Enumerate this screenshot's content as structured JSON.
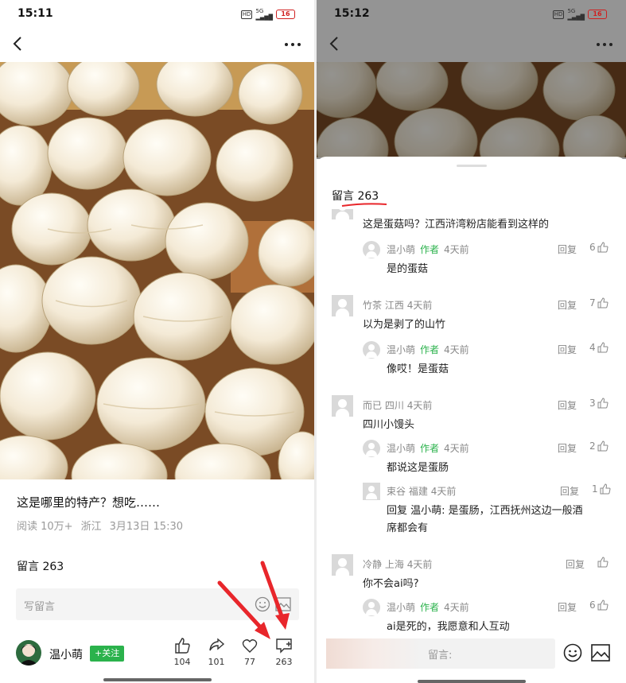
{
  "left": {
    "status": {
      "time": "15:11",
      "battery": "16"
    },
    "post": {
      "title": "这是哪里的特产？想吃……",
      "reads": "阅读 10万+",
      "location": "浙江",
      "datetime": "3月13日 15:30"
    },
    "comments_label": "留言 263",
    "input_placeholder": "写留言",
    "author": {
      "name": "温小萌",
      "follow": "+关注"
    },
    "actions": {
      "like": "104",
      "share": "101",
      "heart": "77",
      "comment": "263"
    }
  },
  "right": {
    "status": {
      "time": "15:12",
      "battery": "16"
    },
    "sheet_title": "留言 263",
    "reply_label": "回复",
    "author_tag": "作者",
    "comments": [
      {
        "text": "这是蛋菇吗？江西浒湾粉店能看到这样的"
      },
      {
        "name": "温小萌",
        "author": true,
        "time": "4天前",
        "likes": "6",
        "text": "是的蛋菇"
      },
      {
        "name": "竹茶",
        "loc": "江西",
        "time": "4天前",
        "likes": "7",
        "text": "以为是剥了的山竹"
      },
      {
        "name": "温小萌",
        "author": true,
        "time": "4天前",
        "likes": "4",
        "text": "像哎！是蛋菇"
      },
      {
        "name": "而已",
        "loc": "四川",
        "time": "4天前",
        "likes": "3",
        "text": "四川小馒头"
      },
      {
        "name": "温小萌",
        "author": true,
        "time": "4天前",
        "likes": "2",
        "text": "都说这是蛋肠"
      },
      {
        "name": "束谷",
        "loc": "福建",
        "time": "4天前",
        "likes": "1",
        "text": "回复 温小萌: 是蛋肠，江西抚州这边一般酒",
        "text2": "席都会有"
      },
      {
        "name": "冷静",
        "loc": "上海",
        "time": "4天前",
        "likes": "",
        "text": "你不会ai吗?"
      },
      {
        "name": "温小萌",
        "author": true,
        "time": "4天前",
        "likes": "6",
        "text": "ai是死的，我愿意和人互动"
      }
    ],
    "input_placeholder": "留言:"
  }
}
